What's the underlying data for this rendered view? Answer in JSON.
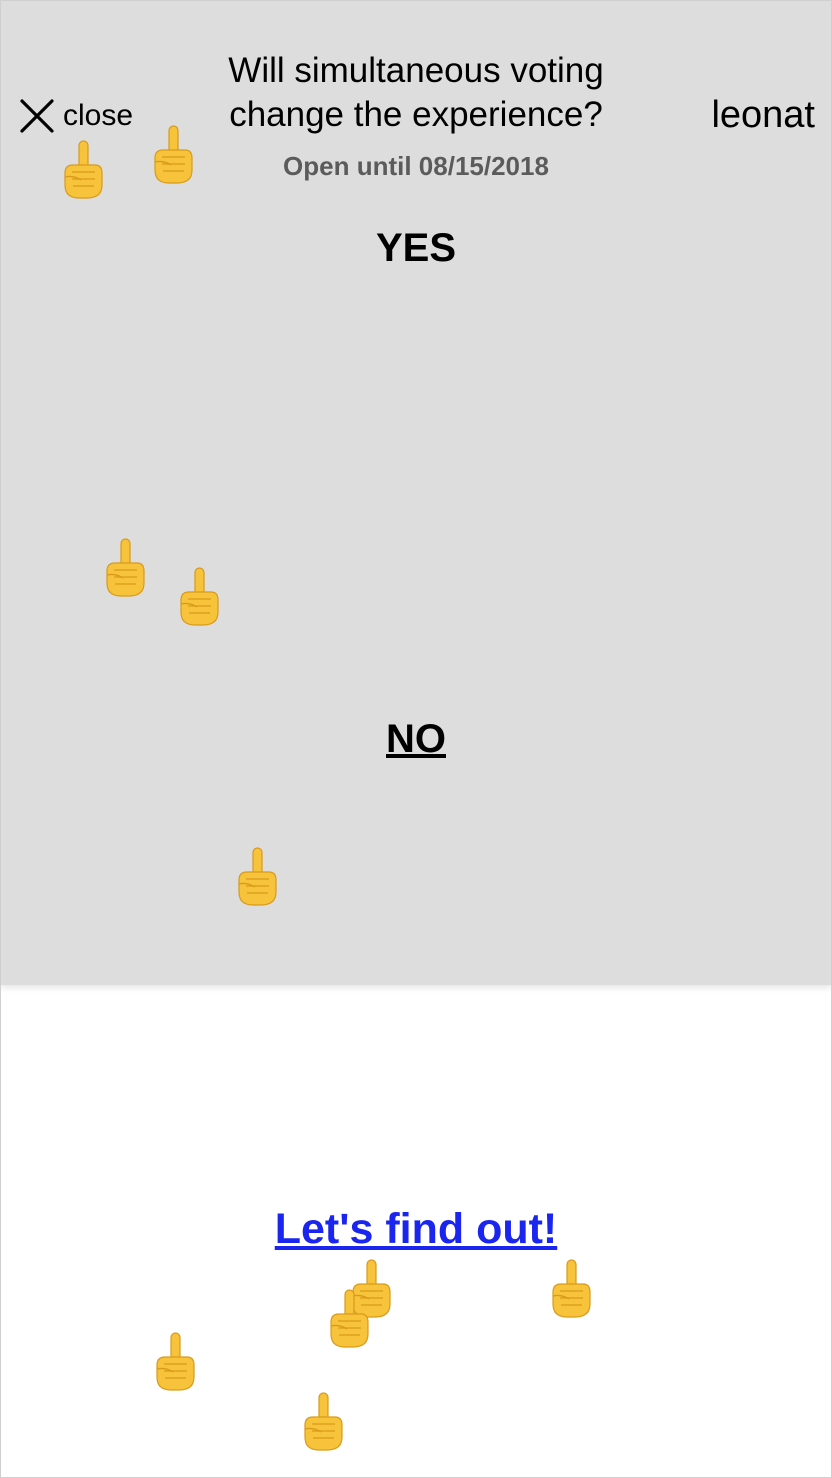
{
  "header": {
    "close_label": "close",
    "question_line1": "Will simultaneous voting",
    "question_line2": "change the experience?",
    "deadline": "Open until 08/15/2018",
    "username": "leonat"
  },
  "options": {
    "yes_label": "YES",
    "no_label": "NO"
  },
  "footer": {
    "result_link": "Let's find out!"
  },
  "icons": {
    "close": "close-x-icon",
    "cursor": "pointing-finger-icon"
  },
  "colors": {
    "panel_background": "#dddddd",
    "page_background": "#ffffff",
    "link": "#1a26f0",
    "deadline_text": "#5b5b5b",
    "pointer_fill": "#f7c33b"
  }
}
